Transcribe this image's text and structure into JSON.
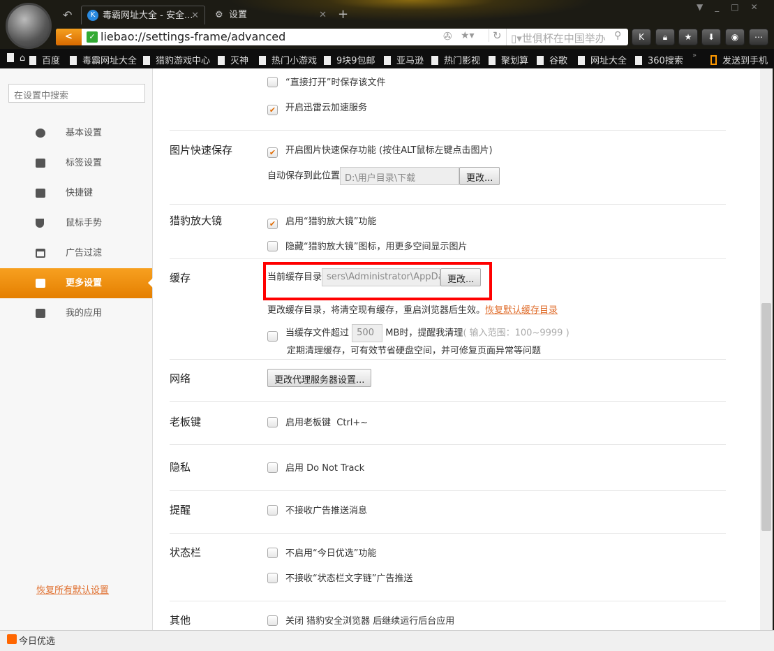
{
  "tabs": [
    {
      "label": "毒霸网址大全 - 安全..."
    },
    {
      "label": "设置"
    }
  ],
  "address": {
    "url": "liebao://settings-frame/advanced",
    "search_placeholder": "世俱杯在中国举办"
  },
  "bookmarks": [
    "百度",
    "毒霸网址大全",
    "猎豹游戏中心",
    "灭神",
    "热门小游戏",
    "9块9包邮",
    "亚马逊",
    "热门影视",
    "聚划算",
    "谷歌",
    "网址大全",
    "360搜索"
  ],
  "send_to_phone": "发送到手机",
  "sidebar": {
    "search_placeholder": "在设置中搜索",
    "items": [
      {
        "label": "基本设置"
      },
      {
        "label": "标签设置"
      },
      {
        "label": "快捷键"
      },
      {
        "label": "鼠标手势"
      },
      {
        "label": "广告过滤"
      },
      {
        "label": "更多设置"
      },
      {
        "label": "我的应用"
      }
    ],
    "restore": "恢复所有默认设置"
  },
  "download": {
    "open_save": "“直接打开”时保存该文件",
    "xunlei": "开启迅雷云加速服务"
  },
  "image_save": {
    "label": "图片快速保存",
    "enable": "开启图片快速保存功能 (按住ALT鼠标左键点击图片)",
    "location_label": "自动保存到此位置",
    "location_value": "D:\\用户目录\\下载",
    "change": "更改..."
  },
  "magnifier": {
    "label": "猎豹放大镜",
    "enable": "启用“猎豹放大镜”功能",
    "hide": "隐藏“猎豹放大镜”图标，用更多空间显示图片"
  },
  "cache": {
    "label": "缓存",
    "dir_label": "当前缓存目录",
    "dir_value": "sers\\Administrator\\AppData\\",
    "change": "更改...",
    "note": "更改缓存目录，将清空现有缓存，重启浏览器后生效。",
    "restore": "恢复默认缓存目录",
    "warn_pre": "当缓存文件超过",
    "warn_value": "500",
    "warn_post": "MB时，提醒我清理",
    "warn_range": "( 输入范围：100~9999 )",
    "warn_desc": "定期清理缓存，可有效节省硬盘空间，并可修复页面异常等问题"
  },
  "network": {
    "label": "网络",
    "proxy": "更改代理服务器设置..."
  },
  "boss": {
    "label": "老板键",
    "enable": "启用老板键",
    "shortcut": "Ctrl+~"
  },
  "privacy": {
    "label": "隐私",
    "dnt": "启用 Do Not Track"
  },
  "remind": {
    "label": "提醒",
    "no_ads": "不接收广告推送消息"
  },
  "statusbar": {
    "label": "状态栏",
    "no_today": "不启用“今日优选”功能",
    "no_text": "不接收“状态栏文字链”广告推送"
  },
  "other": {
    "label": "其他",
    "bg": "关闭 猎豹安全浏览器 后继续运行后台应用"
  },
  "status_bar": {
    "today": "今日优选"
  }
}
